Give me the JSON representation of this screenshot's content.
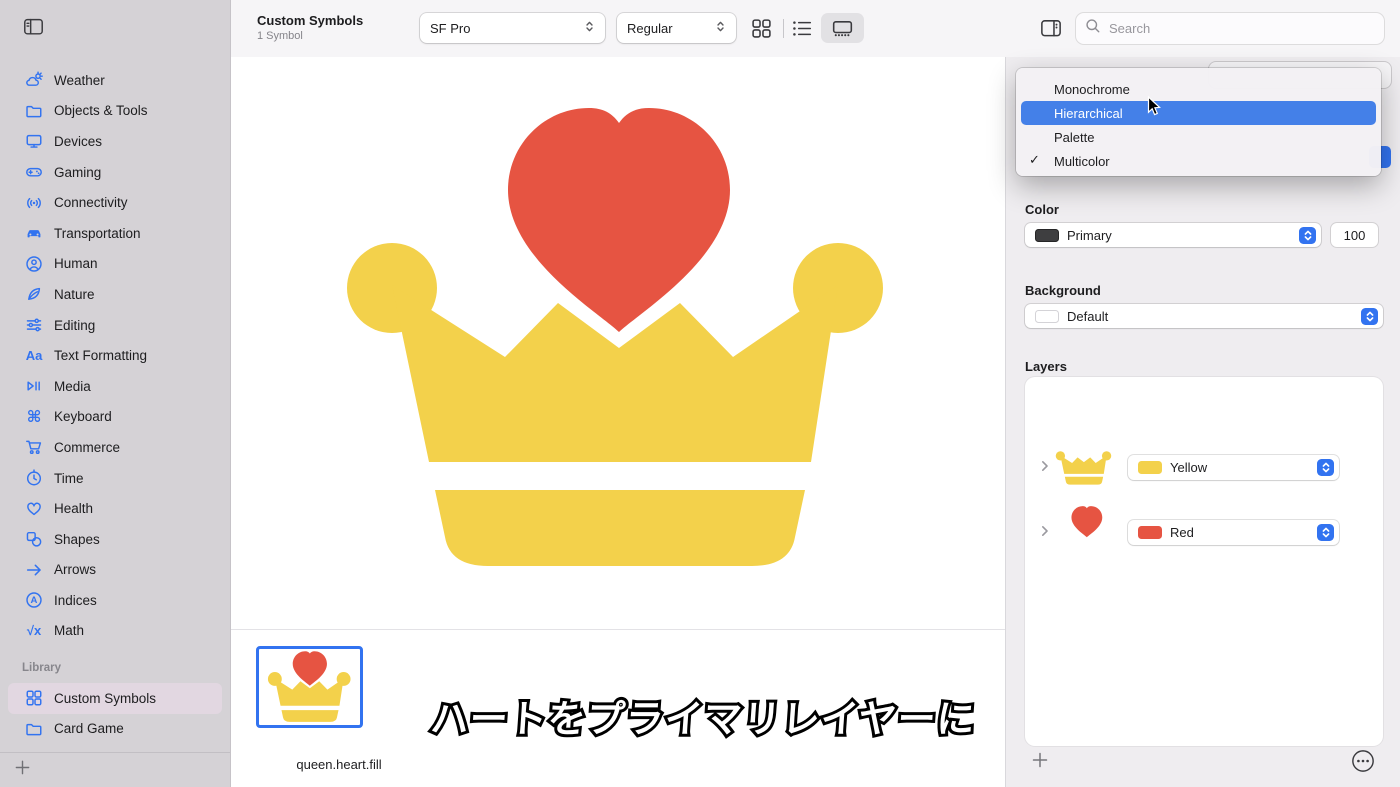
{
  "colors": {
    "accent_blue": "#3273F0",
    "crown_yellow": "#F3D14B",
    "heart_red": "#E65442",
    "menu_highlight": "#4480E8",
    "sidebar_bg": "#D5D2D6",
    "sidebar_selected_bg": "#E2D7E1",
    "toolbar_bg": "#F6F5F7",
    "panel_bg": "#EFEDF0",
    "swatch_dark": "#3E3E40"
  },
  "sidebar": {
    "items": [
      "Weather",
      "Objects & Tools",
      "Devices",
      "Gaming",
      "Connectivity",
      "Transportation",
      "Human",
      "Nature",
      "Editing",
      "Text Formatting",
      "Media",
      "Keyboard",
      "Commerce",
      "Time",
      "Health",
      "Shapes",
      "Arrows",
      "Indices",
      "Math"
    ],
    "library_header": "Library",
    "library_items": [
      "Custom Symbols",
      "Card Game"
    ]
  },
  "icons": {
    "text_formatting": "Aa",
    "keyboard": "⌘",
    "indices_letter": "A",
    "math": "√x"
  },
  "toolbar": {
    "title": "Custom Symbols",
    "subtitle": "1 Symbol",
    "font_popup": "SF Pro",
    "weight_popup": "Regular",
    "search_placeholder": "Search"
  },
  "menu": {
    "check_glyph": "✓",
    "items": [
      {
        "label": "Monochrome"
      },
      {
        "label": "Hierarchical",
        "highlighted": true
      },
      {
        "label": "Palette"
      },
      {
        "label": "Multicolor",
        "checked": true
      }
    ]
  },
  "inspector": {
    "color": {
      "label": "Color",
      "value": "Primary",
      "opacity": "100"
    },
    "background": {
      "label": "Background",
      "value": "Default"
    },
    "layers": {
      "label": "Layers",
      "rows": [
        {
          "name": "Yellow"
        },
        {
          "name": "Red"
        }
      ]
    }
  },
  "canvas": {
    "symbol_name": "queen.heart.fill",
    "caption": "ハートをプライマリレイヤーに"
  }
}
